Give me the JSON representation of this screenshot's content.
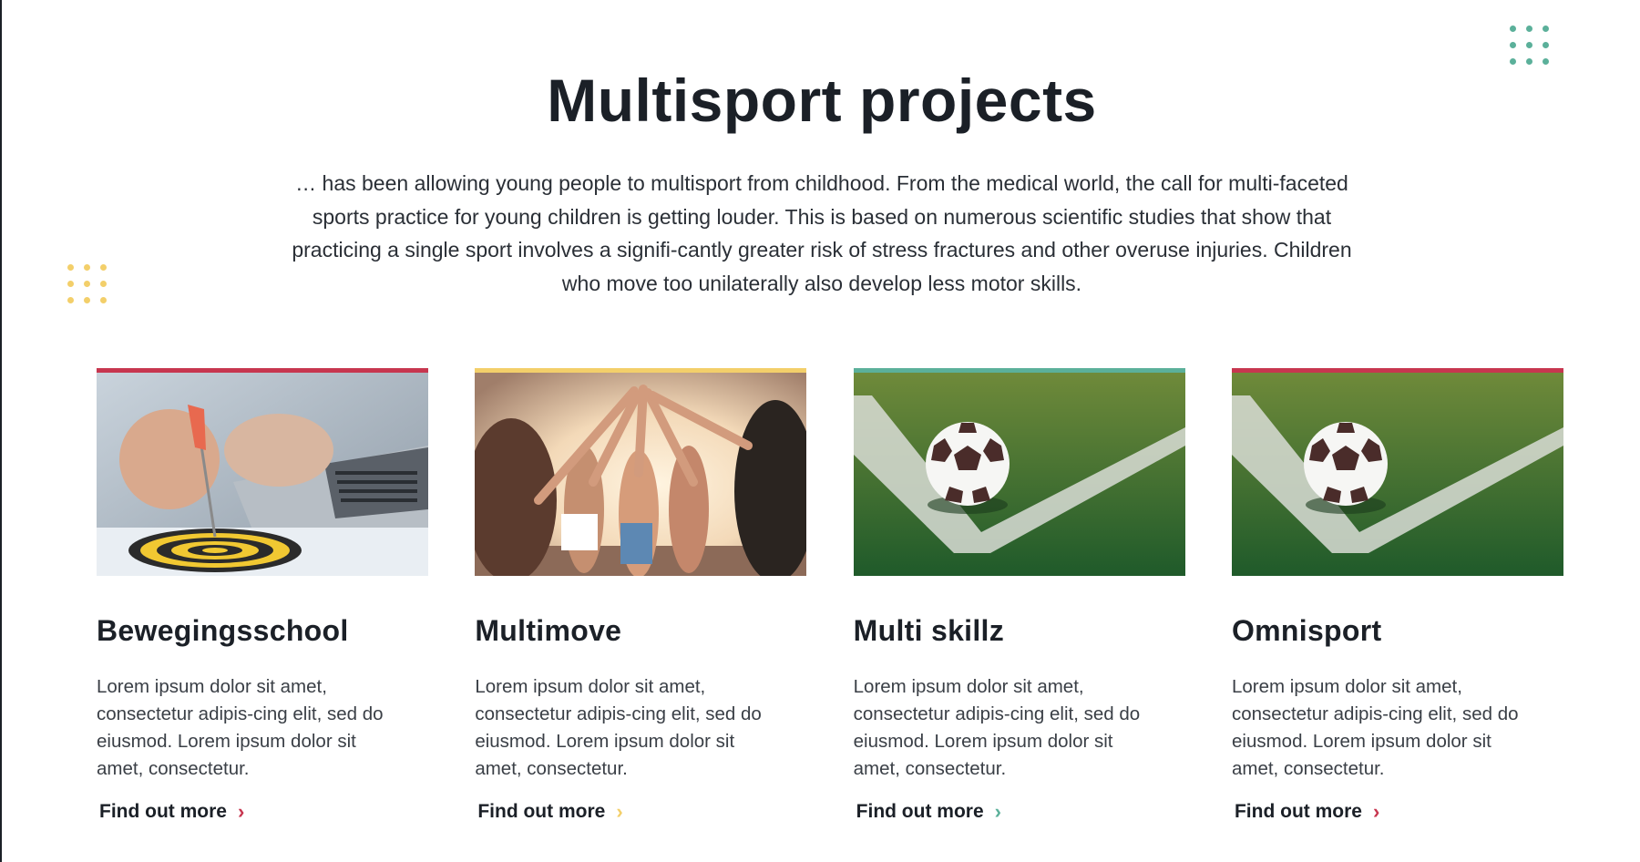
{
  "header": {
    "title": "Multisport projects",
    "intro": "… has been allowing young people to multisport from childhood. From the medical world, the call for multi-faceted sports practice for young children is getting louder. This is based on numerous scientific studies that show that practicing a single sport involves a signifi-cantly greater risk of stress fractures and other overuse injuries. Children who move too unilaterally also develop less motor skills."
  },
  "colors": {
    "red": "#c7364f",
    "yellow": "#f3cf6a",
    "teal": "#5bb09a",
    "dark": "#1b2027"
  },
  "cards": [
    {
      "title": "Bewegingsschool",
      "text": "Lorem ipsum dolor sit amet, consectetur adipis-cing elit, sed do eiusmod. Lorem ipsum dolor sit amet, consectetur.",
      "link": "Find out more",
      "accent": "#c7364f",
      "image": "dart-target-laptop-photo"
    },
    {
      "title": "Multimove",
      "text": "Lorem ipsum dolor sit amet, consectetur adipis-cing elit, sed do eiusmod. Lorem ipsum dolor sit amet, consectetur.",
      "link": "Find out more",
      "accent": "#f3cf6a",
      "image": "team-high-five-photo"
    },
    {
      "title": "Multi skillz",
      "text": "Lorem ipsum dolor sit amet, consectetur adipis-cing elit, sed do eiusmod. Lorem ipsum dolor sit amet, consectetur.",
      "link": "Find out more",
      "accent": "#5bb09a",
      "image": "soccer-ball-pitch-photo"
    },
    {
      "title": "Omnisport",
      "text": "Lorem ipsum dolor sit amet, consectetur adipis-cing elit, sed do eiusmod. Lorem ipsum dolor sit amet, consectetur.",
      "link": "Find out more",
      "accent": "#c7364f",
      "image": "soccer-ball-pitch-photo"
    }
  ],
  "icons": {
    "link_chevron": "chevron-right-icon",
    "decor_top_right": "teal-dot-grid",
    "decor_left": "yellow-dot-grid"
  }
}
